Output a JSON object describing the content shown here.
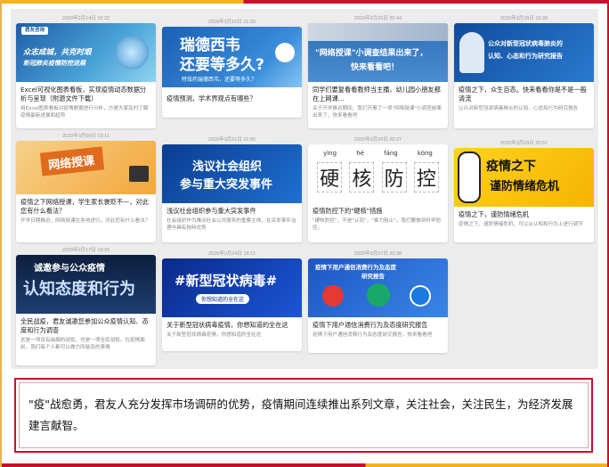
{
  "colors": {
    "brand_red": "#c8102e",
    "brand_gold": "#f6b21a"
  },
  "cards": [
    {
      "date": "2020年2月14日 16:22",
      "thumb_line1": "众志成城，共克时艰",
      "thumb_line2": "新冠肺炎疫情防控进展",
      "logo": "君友咨询",
      "title": "Excel可视化图表看板，实现疫情动态数据分析与呈现（附源文件下载）",
      "desc": "用Excel图表看板对疫情数据进行分析，方便大家及时了解疫情最新进展和趋势"
    },
    {
      "date": "2020年2月16日 21:32",
      "thumb_line1": "瑞德西韦",
      "thumb_line2": "还要等多久?",
      "thumb_sub": "特效药瑞德西韦，还要等多久？",
      "title": "疫情预测，学术界观点有哪些？",
      "desc": ""
    },
    {
      "date": "2020年2月25日 20:44",
      "thumb_line1": "\"网络授课\"小调查结果出来了，",
      "thumb_line2": "快来看看吧！",
      "title": "同学们要复看看教师当主播，幼儿园小朋友都在上网课...",
      "desc": "关于开学推迟期间，我们开展了一项\"网络授课\"小调查结果出来了，快来看看吧"
    },
    {
      "date": "2020年2月28日 19:28",
      "thumb_line1": "公众对新型冠状病毒肺炎的",
      "thumb_line2": "认知、心态和行为研究报告",
      "title": "疫情之下，众生百态。快来看看你是不是一般清流",
      "desc": "公众对新型冠状病毒肺炎的认知、心态和行为研究报告"
    },
    {
      "date": "2020年3月06日 23:11",
      "thumb_line1": "网络授课",
      "title": "疫情之下网络授课，学生家长褒贬不一，对此您有什么看法？",
      "desc": "开学日期推迟，网络授课在各地进行，对此您有什么看法？"
    },
    {
      "date": "2020年3月21日 21:55",
      "thumb_line1": "浅议社会组织",
      "thumb_line2": "参与重大突发事件",
      "title": "浅议社会组织参与重大突发事件",
      "desc": "社会组织作为推动社会公共服务的重要主体，在突发事件治理中具有独特优势"
    },
    {
      "date": "2020年2月26日 20:27",
      "pinyin": [
        "yìng",
        "hé",
        "fáng",
        "kòng"
      ],
      "hanzi": [
        "硬",
        "核",
        "防",
        "控"
      ],
      "title": "疫情防控下的\"硬核\"措施",
      "desc": "\"硬核防控\"，不是\"认同\"，\"奋力阻止\"，我们要做到科学防控。"
    },
    {
      "date": "2020年3月29日 20:57",
      "thumb_line1": "疫情之下",
      "thumb_line2": "谨防情绪危机",
      "title": "疫情之下，谨防情绪危机",
      "desc": "疫情之下，谨防情绪危机，可以从认知和行为上进行调节"
    },
    {
      "date": "2020年2月17日 19:15",
      "thumb_line1": "诚邀参与公众疫情",
      "thumb_line2": "认知态度和行为",
      "title": "全民战疫，君友诚邀您参加公众疫情认知、态度和行为调查",
      "desc": "这是一项没有硝烟的战役，也是一项全民战役。在疫情面前，我们每个人都可以做力所能及的事情"
    },
    {
      "date": "2020年2月24日 18:11",
      "thumb_line1": "#新型冠状病毒#",
      "thumb_sub": "你想知道的全在这",
      "title": "关于新型冠状病毒疫情，你想知道的全在这",
      "desc": "关于新型冠状病毒疫情，你想知道的全在这"
    },
    {
      "date": "2020年3月27日 20:38",
      "thumb_line1": "疫情下用户通信消费行为及态度",
      "thumb_line2": "研究报告",
      "title": "疫情下用户通信消费行为及态度研究报告",
      "desc": "疫情下用户通信消费行为及态度研究报告，快来看看吧"
    }
  ],
  "caption": "\"疫\"战愈勇，君友人充分发挥市场调研的优势，疫情期间连续推出系列文章，关注社会，关注民生，为经济发展建言献智。"
}
